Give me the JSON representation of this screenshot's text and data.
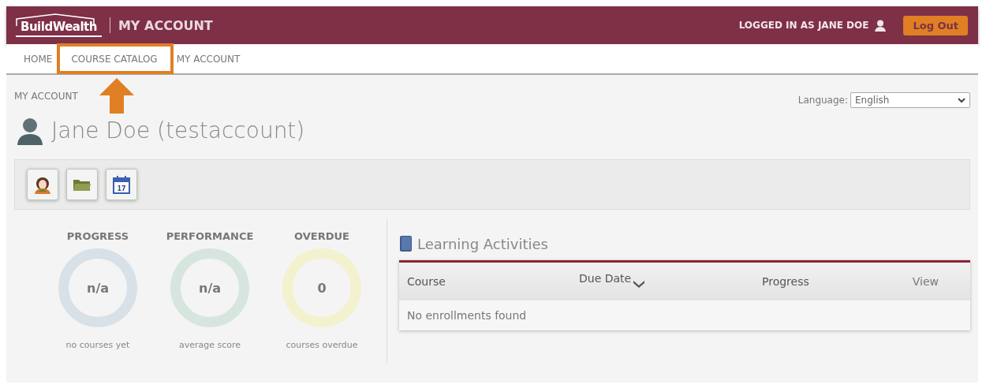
{
  "header": {
    "logo": "BuildWealth",
    "title": "MY ACCOUNT",
    "logged_in": "LOGGED IN AS JANE DOE",
    "logout": "Log Out"
  },
  "nav": [
    {
      "label": "HOME",
      "highlighted": false
    },
    {
      "label": "COURSE CATALOG",
      "highlighted": true
    },
    {
      "label": "MY ACCOUNT",
      "highlighted": false
    }
  ],
  "breadcrumb": "MY ACCOUNT",
  "language": {
    "label": "Language:",
    "value": "English"
  },
  "user_name": "Jane Doe (testaccount)",
  "tools": [
    {
      "kind": "profile"
    },
    {
      "kind": "folder"
    },
    {
      "kind": "calendar",
      "text": "17"
    }
  ],
  "stats": [
    {
      "title": "PROGRESS",
      "value": "n/a",
      "caption": "no courses yet",
      "color": "#d8e0e8"
    },
    {
      "title": "PERFORMANCE",
      "value": "n/a",
      "caption": "average score",
      "color": "#d6e6de"
    },
    {
      "title": "OVERDUE",
      "value": "0",
      "caption": "courses overdue",
      "color": "#f4f1cf"
    }
  ],
  "activities": {
    "title": "Learning Activities",
    "columns": [
      {
        "label": "Course",
        "sorted": false
      },
      {
        "label": "Due Date",
        "sorted": true
      },
      {
        "label": "Progress",
        "sorted": false
      },
      {
        "label": "View",
        "sorted": false
      }
    ],
    "empty": "No enrollments found"
  }
}
